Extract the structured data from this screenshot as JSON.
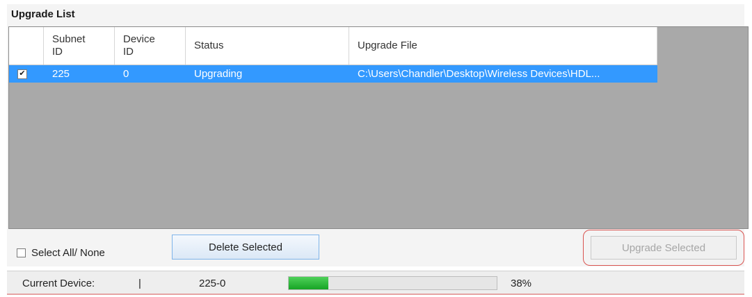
{
  "panel": {
    "title": "Upgrade List"
  },
  "grid": {
    "columns": [
      {
        "label": ""
      },
      {
        "label": "Subnet\nID"
      },
      {
        "label": "Device\nID"
      },
      {
        "label": "Status"
      },
      {
        "label": "Upgrade File"
      }
    ],
    "rows": [
      {
        "checked": true,
        "check_glyph": "✔",
        "subnet_id": "225",
        "device_id": "0",
        "status": "Upgrading",
        "file": "C:\\Users\\Chandler\\Desktop\\Wireless Devices\\HDL..."
      }
    ],
    "colors": {
      "selected_row": "#3399ff",
      "empty_area": "#a9a9a9"
    }
  },
  "controls": {
    "select_all_label": "Select All/ None",
    "select_all_checked": false,
    "delete_label": "Delete Selected",
    "upgrade_label": "Upgrade Selected",
    "upgrade_disabled": true,
    "highlight_color": "#d9534f"
  },
  "status": {
    "current_label": "Current Device:",
    "divider": "|",
    "device": "225-0",
    "progress_fraction": 0.19,
    "progress_text": "38%",
    "progress_color": "#16a424"
  }
}
